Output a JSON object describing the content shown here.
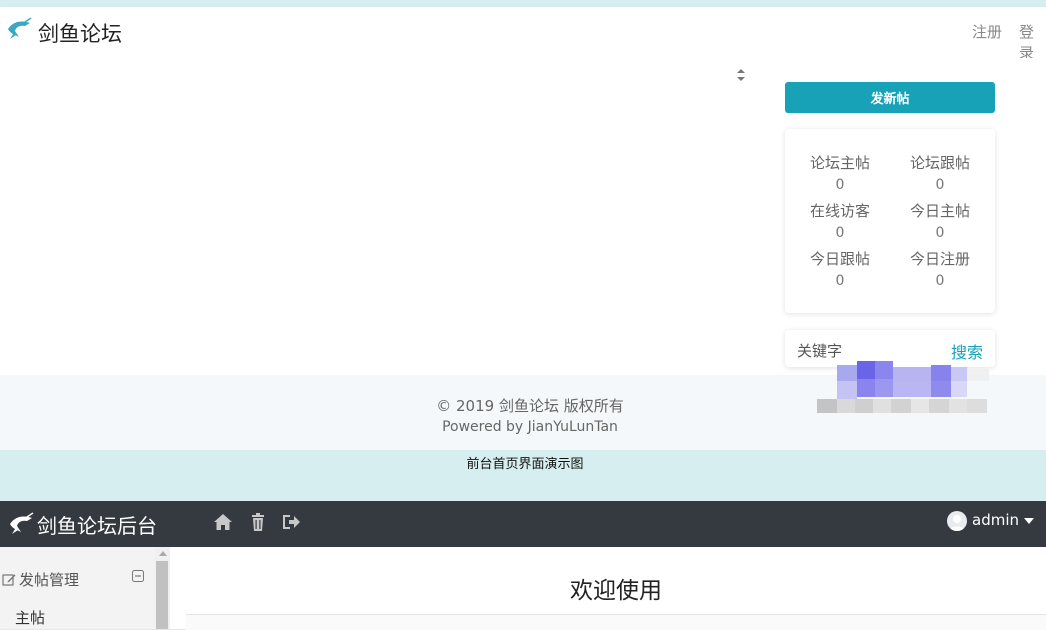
{
  "front": {
    "site_title": "剑鱼论坛",
    "nav": {
      "register": "注册",
      "login": "登录"
    },
    "new_post_button": "发新帖",
    "stats": [
      {
        "label": "论坛主帖",
        "value": "0"
      },
      {
        "label": "论坛跟帖",
        "value": "0"
      },
      {
        "label": "在线访客",
        "value": "0"
      },
      {
        "label": "今日主帖",
        "value": "0"
      },
      {
        "label": "今日跟帖",
        "value": "0"
      },
      {
        "label": "今日注册",
        "value": "0"
      }
    ],
    "search": {
      "keyword_label": "关键字",
      "button": "搜索"
    },
    "footer": {
      "copyright": "© 2019 剑鱼论坛 版权所有",
      "powered": "Powered by JianYuLunTan"
    },
    "colors": {
      "accent": "#17a2b8",
      "page_bg": "#d7eef0"
    }
  },
  "caption": "前台首页界面演示图",
  "admin": {
    "title": "剑鱼论坛后台",
    "toolbar_icons": [
      "home-icon",
      "trash-icon",
      "logout-icon"
    ],
    "user": "admin",
    "sidebar": {
      "section_label": "发帖管理",
      "items": [
        "主帖"
      ]
    },
    "welcome": "欢迎使用",
    "colors": {
      "header_bg": "#343a40"
    }
  }
}
